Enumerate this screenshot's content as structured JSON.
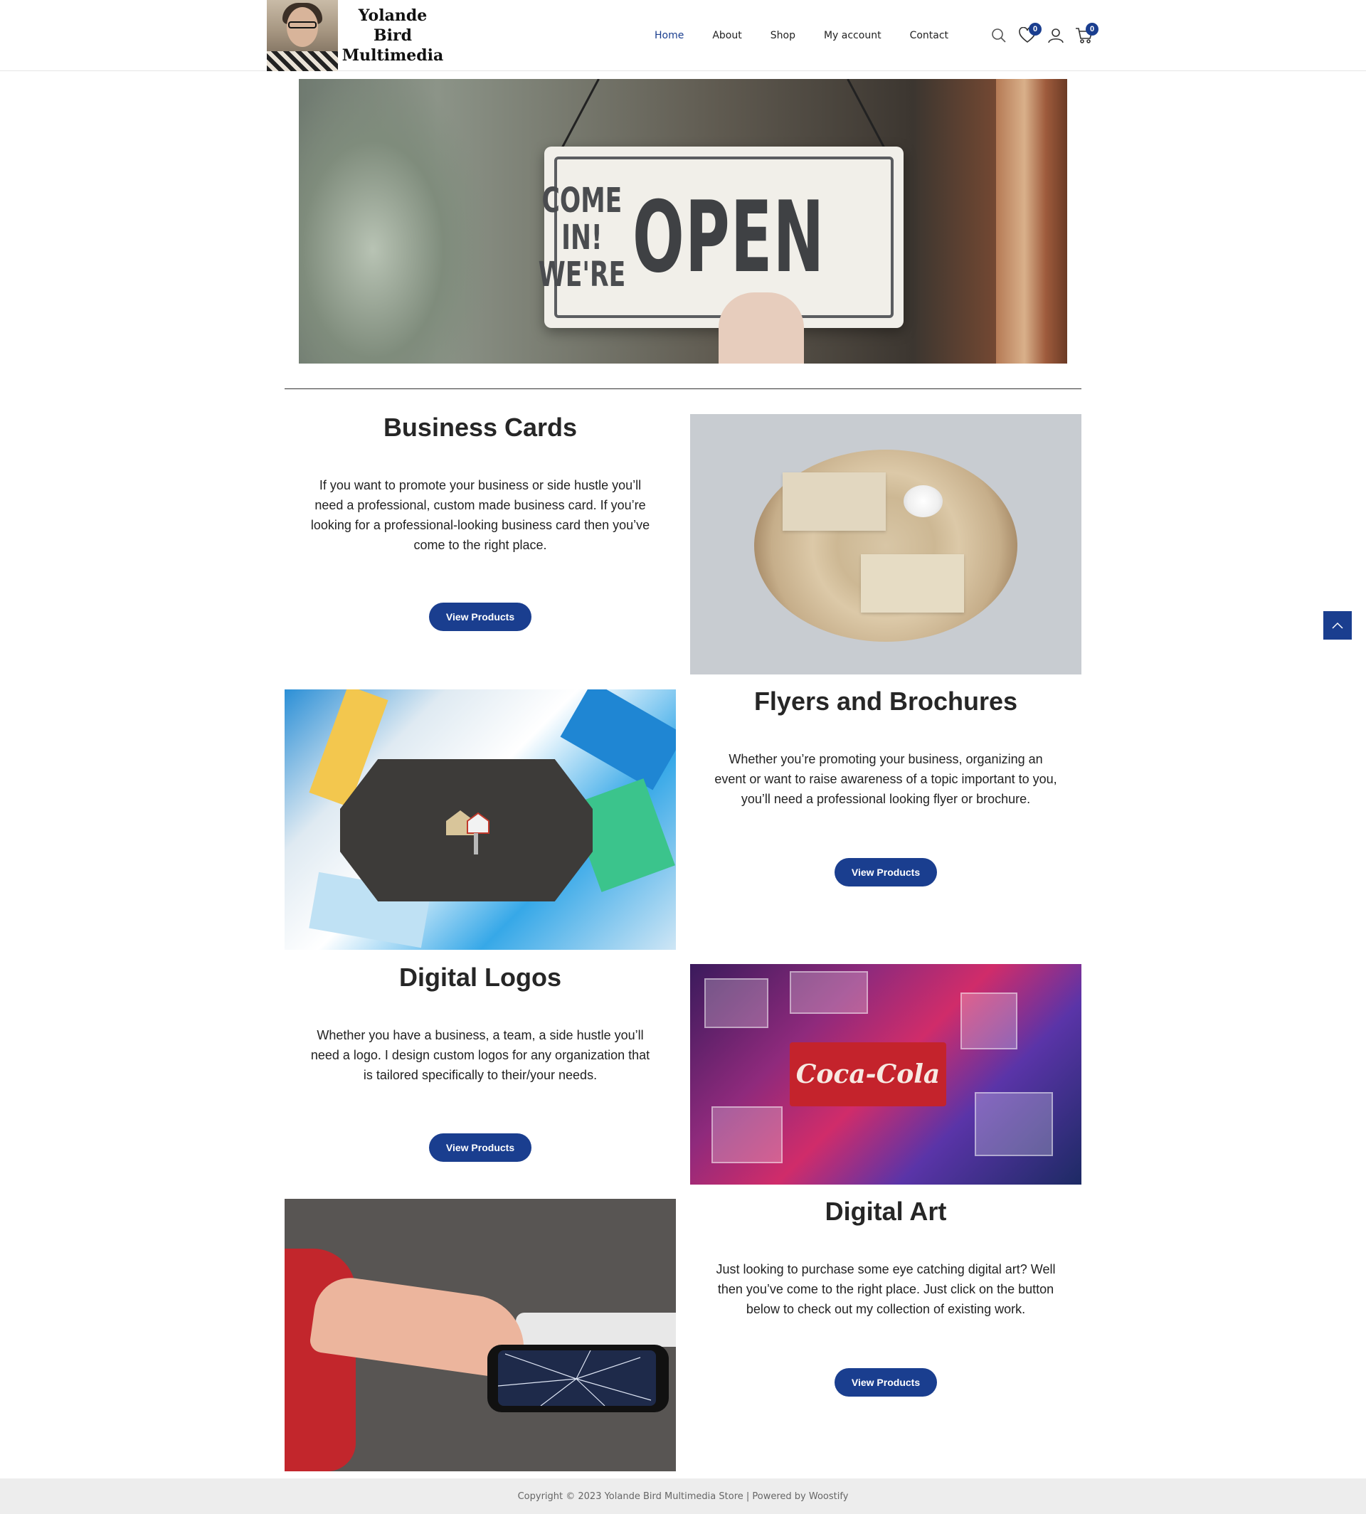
{
  "brand": {
    "line1": "Yolande",
    "line2": "Bird",
    "line3": "Multimedia"
  },
  "nav": {
    "items": [
      {
        "label": "Home",
        "active": true
      },
      {
        "label": "About"
      },
      {
        "label": "Shop"
      },
      {
        "label": "My account"
      },
      {
        "label": "Contact"
      }
    ]
  },
  "header_icons": {
    "search": "search-icon",
    "wishlist": "heart-icon",
    "wishlist_count": "0",
    "account": "user-icon",
    "cart": "cart-icon",
    "cart_count": "0"
  },
  "hero": {
    "sign_small_line1": "COME IN!",
    "sign_small_line2": "WE'RE",
    "sign_big": "OPEN"
  },
  "sections": [
    {
      "title": "Business Cards",
      "text": "If you want to promote your business or side hustle you’ll need a professional, custom made business card. If you’re looking for a professional-looking business card then you’ve come to the right place.",
      "button": "View Products"
    },
    {
      "title": "Flyers and Brochures",
      "text": "Whether you’re promoting your business, organizing an event or want to raise awareness of a topic important to you, you’ll need a professional looking flyer or brochure.",
      "button": "View Products"
    },
    {
      "title": "Digital Logos",
      "text": "Whether you have a business, a team, a side hustle you’ll need a logo. I design custom logos for any organization that is tailored specifically to their/your needs.",
      "button": "View Products"
    },
    {
      "title": "Digital Art",
      "text": "Just looking to purchase some eye catching digital art? Well then you’ve come to the right place. Just click on the button below to check out my collection of existing work.",
      "button": "View Products"
    }
  ],
  "images": {
    "logos_sign": "Coca-Cola"
  },
  "colors": {
    "accent": "#1a3e8f",
    "footer_bg": "#ededed"
  },
  "footer": {
    "text": "Copyright © 2023 Yolande Bird Multimedia Store | Powered by Woostify"
  }
}
